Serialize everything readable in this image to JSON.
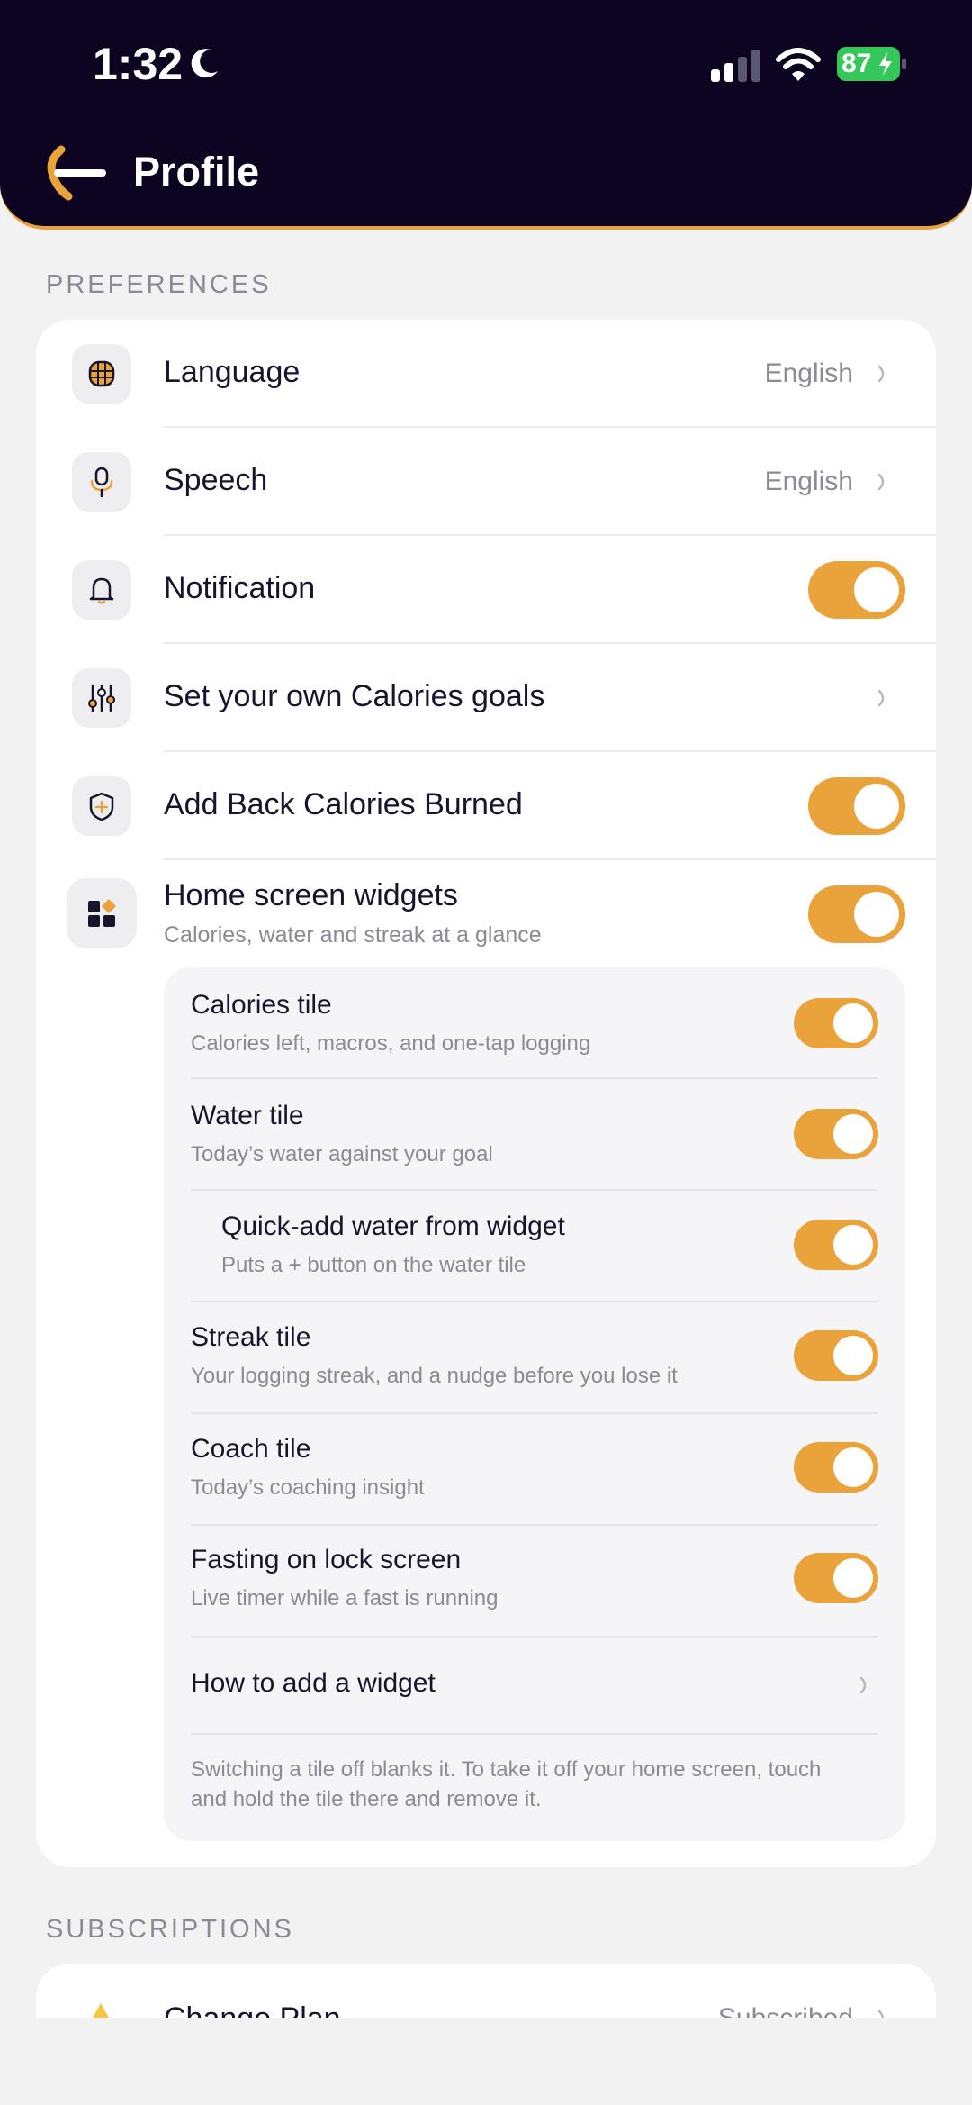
{
  "status_bar": {
    "time": "1:32",
    "battery": "87"
  },
  "header": {
    "title": "Profile"
  },
  "sections": {
    "preferences_label": "PREFERENCES",
    "subscriptions_label": "SUBSCRIPTIONS"
  },
  "preferences": {
    "language": {
      "label": "Language",
      "value": "English"
    },
    "speech": {
      "label": "Speech",
      "value": "English"
    },
    "notification": {
      "label": "Notification",
      "on": true
    },
    "calorie_goals": {
      "label": "Set your own Calories goals"
    },
    "add_back": {
      "label": "Add Back Calories Burned",
      "on": true
    },
    "widgets": {
      "label": "Home screen widgets",
      "sub": "Calories, water and streak at a glance",
      "on": true
    }
  },
  "widget_tiles": {
    "calories": {
      "title": "Calories tile",
      "desc": "Calories left, macros, and one-tap logging"
    },
    "water": {
      "title": "Water tile",
      "desc": "Today’s water against your goal"
    },
    "quick_add": {
      "title": "Quick-add water from widget",
      "desc": "Puts a + button on the water tile"
    },
    "streak": {
      "title": "Streak tile",
      "desc": "Your logging streak, and a nudge before you lose it"
    },
    "coach": {
      "title": "Coach tile",
      "desc": "Today’s coaching insight"
    },
    "fasting": {
      "title": "Fasting on lock screen",
      "desc": "Live timer while a fast is running"
    },
    "how_to": {
      "title": "How to add a widget"
    },
    "footnote": "Switching a tile off blanks it. To take it off your home screen, touch and hold the tile there and remove it."
  },
  "subscriptions": {
    "change_plan": {
      "label": "Change Plan",
      "value": "Subscribed"
    }
  },
  "colors": {
    "accent": "#eaa23a",
    "header_bg": "#0c0420",
    "battery_green": "#34c759"
  }
}
